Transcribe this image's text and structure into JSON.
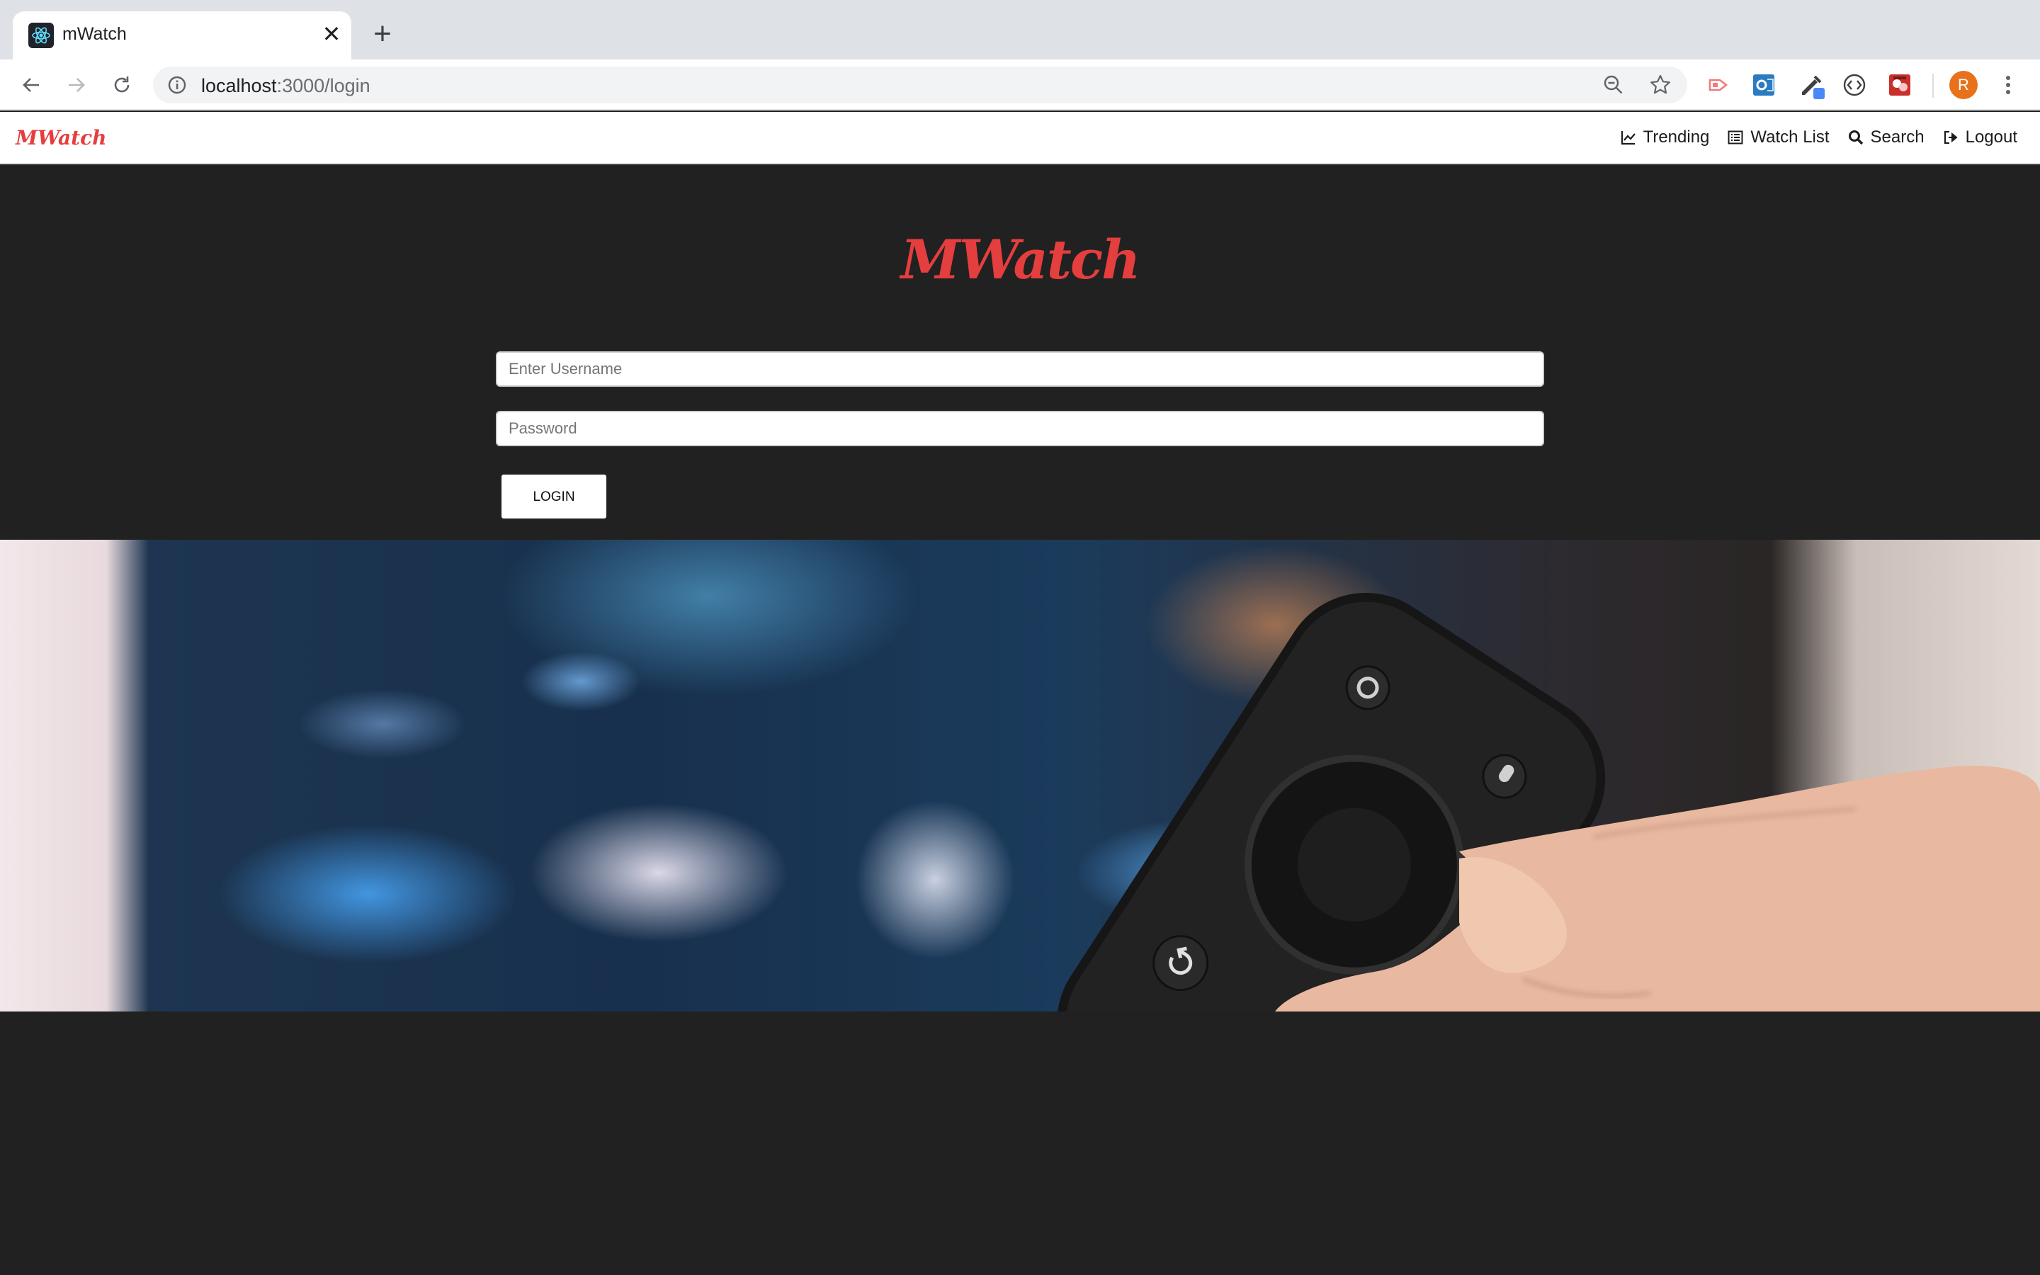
{
  "browser": {
    "tab_title": "mWatch",
    "url_host": "localhost",
    "url_rest": ":3000/login",
    "profile_initial": "R"
  },
  "navbar": {
    "brand": "MWatch",
    "links": [
      {
        "label": "Trending",
        "icon": "chart-line-icon"
      },
      {
        "label": "Watch List",
        "icon": "list-icon"
      },
      {
        "label": "Search",
        "icon": "search-icon"
      },
      {
        "label": "Logout",
        "icon": "logout-icon"
      }
    ]
  },
  "login": {
    "logo": "MWatch",
    "username_placeholder": "Enter Username",
    "password_placeholder": "Password",
    "button_label": "LOGIN"
  },
  "colors": {
    "brand": "#e53e3e",
    "background": "#212121"
  }
}
